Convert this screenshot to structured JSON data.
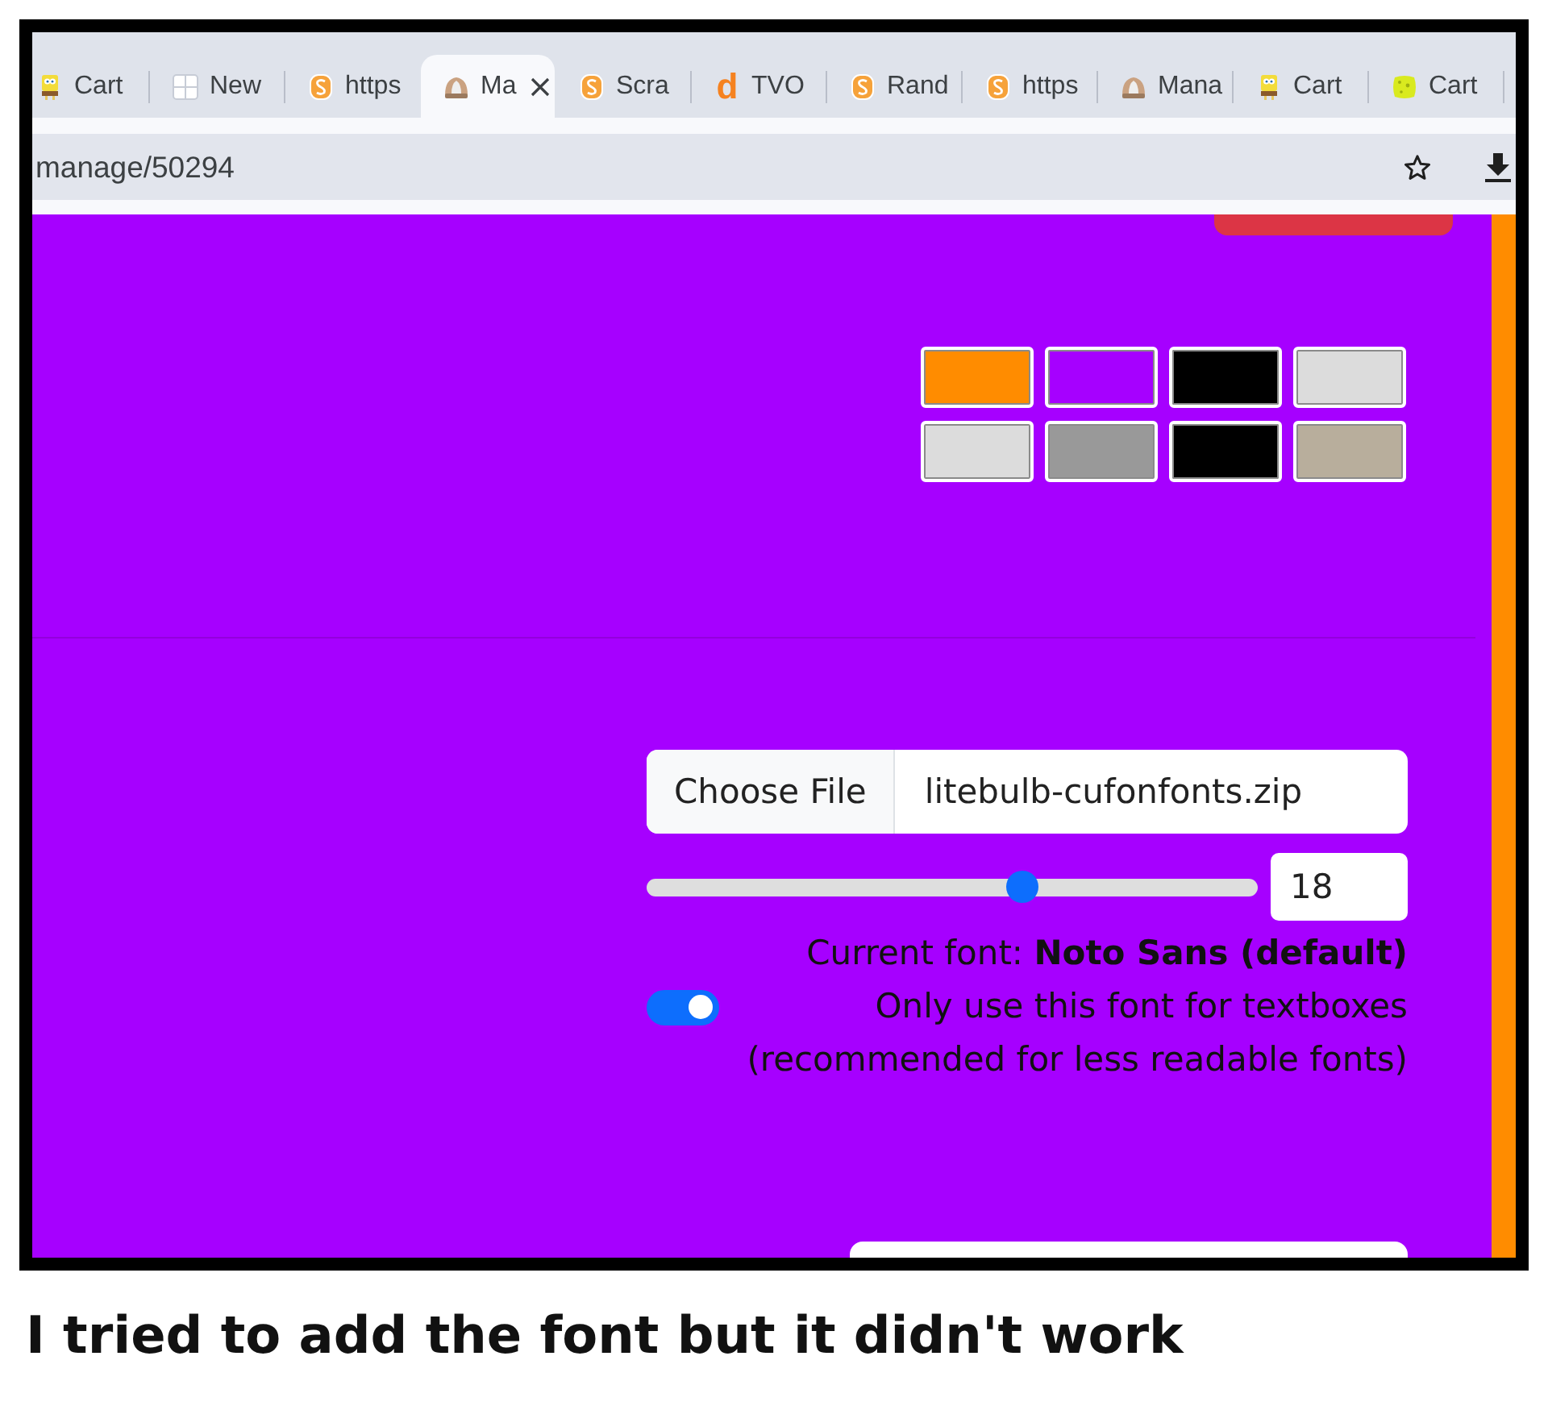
{
  "browser": {
    "tabs": [
      {
        "title": "Cart",
        "kind": "figure",
        "selected": false
      },
      {
        "title": "New",
        "kind": "grid",
        "selected": false
      },
      {
        "title": "https",
        "kind": "badge",
        "selected": false
      },
      {
        "title": "Ma",
        "kind": "dome",
        "selected": true
      },
      {
        "title": "Scra",
        "kind": "badge",
        "selected": false
      },
      {
        "title": "TVO",
        "kind": "letter",
        "icon_text": "d",
        "selected": false
      },
      {
        "title": "Rand",
        "kind": "badge",
        "selected": false
      },
      {
        "title": "https",
        "kind": "badge",
        "selected": false
      },
      {
        "title": "Mana",
        "kind": "dome",
        "selected": false
      },
      {
        "title": "Cart",
        "kind": "figure",
        "selected": false
      },
      {
        "title": "Cart",
        "kind": "sponge",
        "selected": false
      }
    ],
    "address": "manage/50294"
  },
  "page": {
    "swatches": [
      {
        "color": "#ff8c00"
      },
      {
        "color": "#a600ff"
      },
      {
        "color": "#000000"
      },
      {
        "color": "#dcdcdc"
      },
      {
        "color": "#dcdcdc"
      },
      {
        "color": "#999999"
      },
      {
        "color": "#000000"
      },
      {
        "color": "#b8ae9c"
      }
    ],
    "font_file": {
      "button": "Choose File",
      "file_name": "litebulb-cufonfonts.zip"
    },
    "font_size": {
      "level": 0.62,
      "value": "18"
    },
    "current_font": "Current font: **Noto Sans (default)**",
    "textbox_only": {
      "on": true,
      "label": "Only use this font for textboxes",
      "note": "(recommended for less readable fonts)"
    }
  },
  "caption": "I tried to add the font but it didn't work"
}
